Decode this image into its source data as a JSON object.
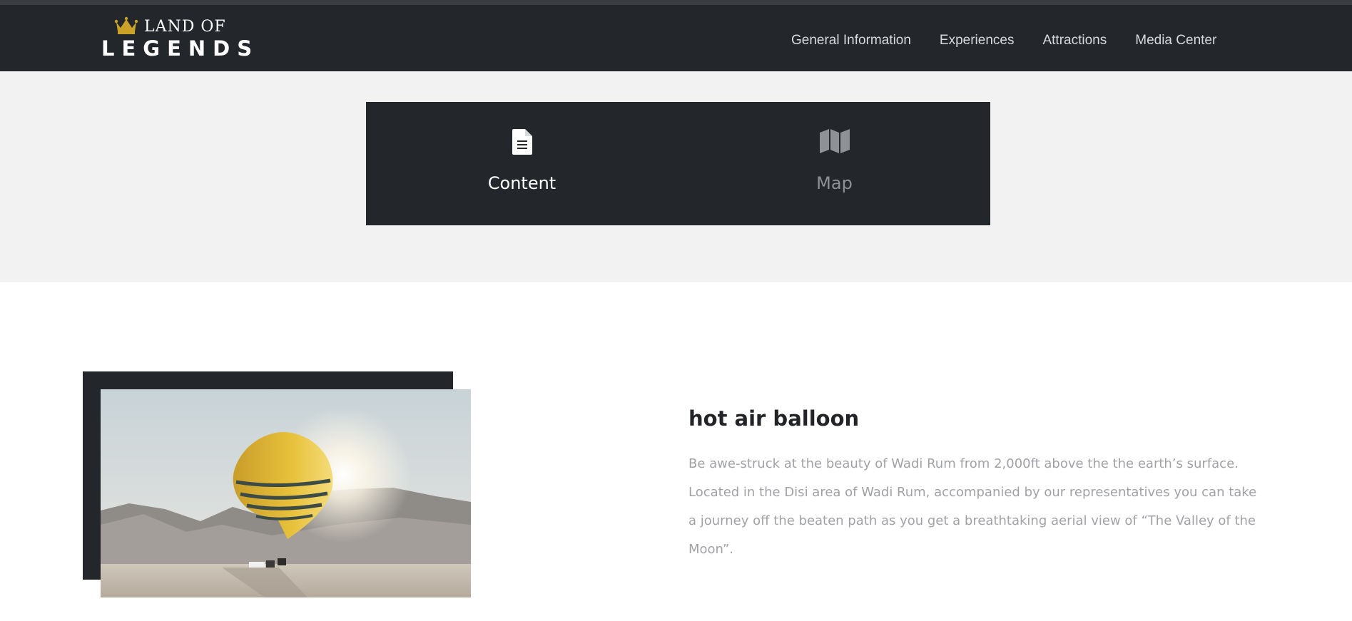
{
  "brand": {
    "logo_top": "LAND OF",
    "logo_bottom": "LEGENDS",
    "logo_icon": "crown-icon",
    "accent": "#c9a227"
  },
  "nav": {
    "items": [
      {
        "label": "General Information"
      },
      {
        "label": "Experiences"
      },
      {
        "label": "Attractions"
      },
      {
        "label": "Media Center"
      }
    ]
  },
  "tabs": [
    {
      "label": "Content",
      "icon": "document-icon",
      "active": true
    },
    {
      "label": "Map",
      "icon": "map-icon",
      "active": false
    }
  ],
  "experience": {
    "title": "hot air balloon",
    "description": "Be awe-struck at the beauty of Wadi Rum from 2,000ft above the the earth’s surface. Located in the Disi area of Wadi Rum, accompanied by our representatives you can take a journey off the beaten path as you get a breathtaking aerial view of “The Valley of the Moon”."
  },
  "colors": {
    "header_bg": "#23262b",
    "section_bg": "#f2f2f2",
    "text_muted": "#a0a2a6"
  }
}
